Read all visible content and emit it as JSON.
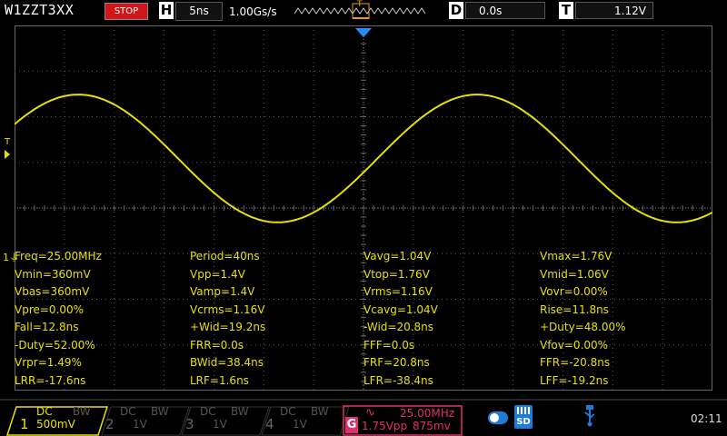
{
  "top": {
    "model": "W1ZZT3XX",
    "run_status": "STOP",
    "horizontal_key": "H",
    "timebase": "5ns",
    "sample_rate": "1.00Gs/s",
    "trigger_strip_marker": "T",
    "delay_key": "D",
    "delay": "0.0s",
    "trigger_key": "T",
    "trigger_level": "1.12V"
  },
  "screen": {
    "trigger_marker": "T",
    "channel_marker": "1",
    "trace_color": "#e8e000",
    "trace_period_ns": 40,
    "trace_vmin": 0.36,
    "trace_vmax": 1.76
  },
  "measurements": [
    [
      "Freq=25.00MHz",
      "Period=40ns",
      "Vavg=1.04V",
      "Vmax=1.76V"
    ],
    [
      "Vmin=360mV",
      "Vpp=1.4V",
      "Vtop=1.76V",
      "Vmid=1.06V"
    ],
    [
      "Vbas=360mV",
      "Vamp=1.4V",
      "Vrms=1.16V",
      "Vovr=0.00%"
    ],
    [
      "Vpre=0.00%",
      "Vcrms=1.16V",
      "Vcavg=1.04V",
      "Rise=11.8ns"
    ],
    [
      "Fall=12.8ns",
      "+Wid=19.2ns",
      "-Wid=20.8ns",
      "+Duty=48.00%"
    ],
    [
      "-Duty=52.00%",
      "FRR=0.0s",
      "FFF=0.0s",
      "Vfov=0.00%"
    ],
    [
      "Vrpr=1.49%",
      "BWid=38.4ns",
      "FRF=20.8ns",
      "FFR=-20.8ns"
    ],
    [
      "LRR=-17.6ns",
      "LRF=1.6ns",
      "LFR=-38.4ns",
      "LFF=-19.2ns"
    ]
  ],
  "channels": [
    {
      "num": "1",
      "coupling": "DC",
      "bw": "BW",
      "scale": "500mV",
      "active": true,
      "color": "#e8e000"
    },
    {
      "num": "2",
      "coupling": "DC",
      "bw": "BW",
      "scale": "1V",
      "active": false,
      "color": "#555555"
    },
    {
      "num": "3",
      "coupling": "DC",
      "bw": "BW",
      "scale": "1V",
      "active": false,
      "color": "#555555"
    },
    {
      "num": "4",
      "coupling": "DC",
      "bw": "BW",
      "scale": "1V",
      "active": false,
      "color": "#555555"
    }
  ],
  "generator": {
    "key": "G",
    "freq": "25.00MHz",
    "amplitude": "1.75Vpp",
    "offset": "875mv",
    "color": "#e0306a"
  },
  "status_icons": [
    "bluetooth-toggle-icon",
    "sd-card-icon",
    "usb-icon"
  ],
  "clock": "02:11"
}
